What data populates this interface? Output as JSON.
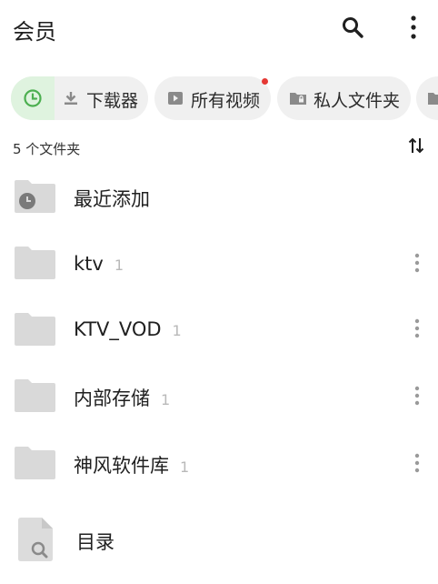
{
  "header": {
    "title": "会员",
    "search_icon": "search-icon",
    "menu_icon": "more-vertical-icon"
  },
  "chips": [
    {
      "label": "",
      "icon": "clock-icon",
      "active": true
    },
    {
      "label": "下载器",
      "icon": "download-icon"
    },
    {
      "label": "所有视频",
      "icon": "video-icon",
      "badge": true
    },
    {
      "label": "私人文件夹",
      "icon": "lock-folder-icon"
    },
    {
      "label": "",
      "icon": "folder-icon"
    }
  ],
  "list": {
    "count_label": "5 个文件夹",
    "sort_icon": "sort-icon",
    "items": [
      {
        "name": "最近添加",
        "count": "",
        "icon": "recent-folder-icon"
      },
      {
        "name": "ktv",
        "count": "1",
        "icon": "folder-icon"
      },
      {
        "name": "KTV_VOD",
        "count": "1",
        "icon": "folder-icon"
      },
      {
        "name": "内部存储",
        "count": "1",
        "icon": "folder-icon"
      },
      {
        "name": "神风软件库",
        "count": "1",
        "icon": "folder-icon"
      },
      {
        "name": "目录",
        "count": "",
        "icon": "search-file-icon"
      }
    ]
  },
  "colors": {
    "accent_green": "#4caf50",
    "chip_bg": "#f0f0f0",
    "active_chip_bg": "#dff3df",
    "folder": "#d9d9d9",
    "badge_red": "#e53935"
  }
}
